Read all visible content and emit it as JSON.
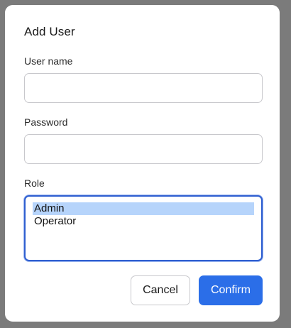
{
  "dialog": {
    "title": "Add User",
    "username_label": "User name",
    "username_value": "",
    "password_label": "Password",
    "password_value": "",
    "role_label": "Role",
    "role_options": [
      "Admin",
      "Operator"
    ],
    "role_selected": "Admin",
    "cancel_label": "Cancel",
    "confirm_label": "Confirm"
  },
  "colors": {
    "overlay": "#7b7b7b",
    "primary": "#2b6ee8",
    "focus_border": "#2f5fd0",
    "selection": "#b6d4fb"
  }
}
